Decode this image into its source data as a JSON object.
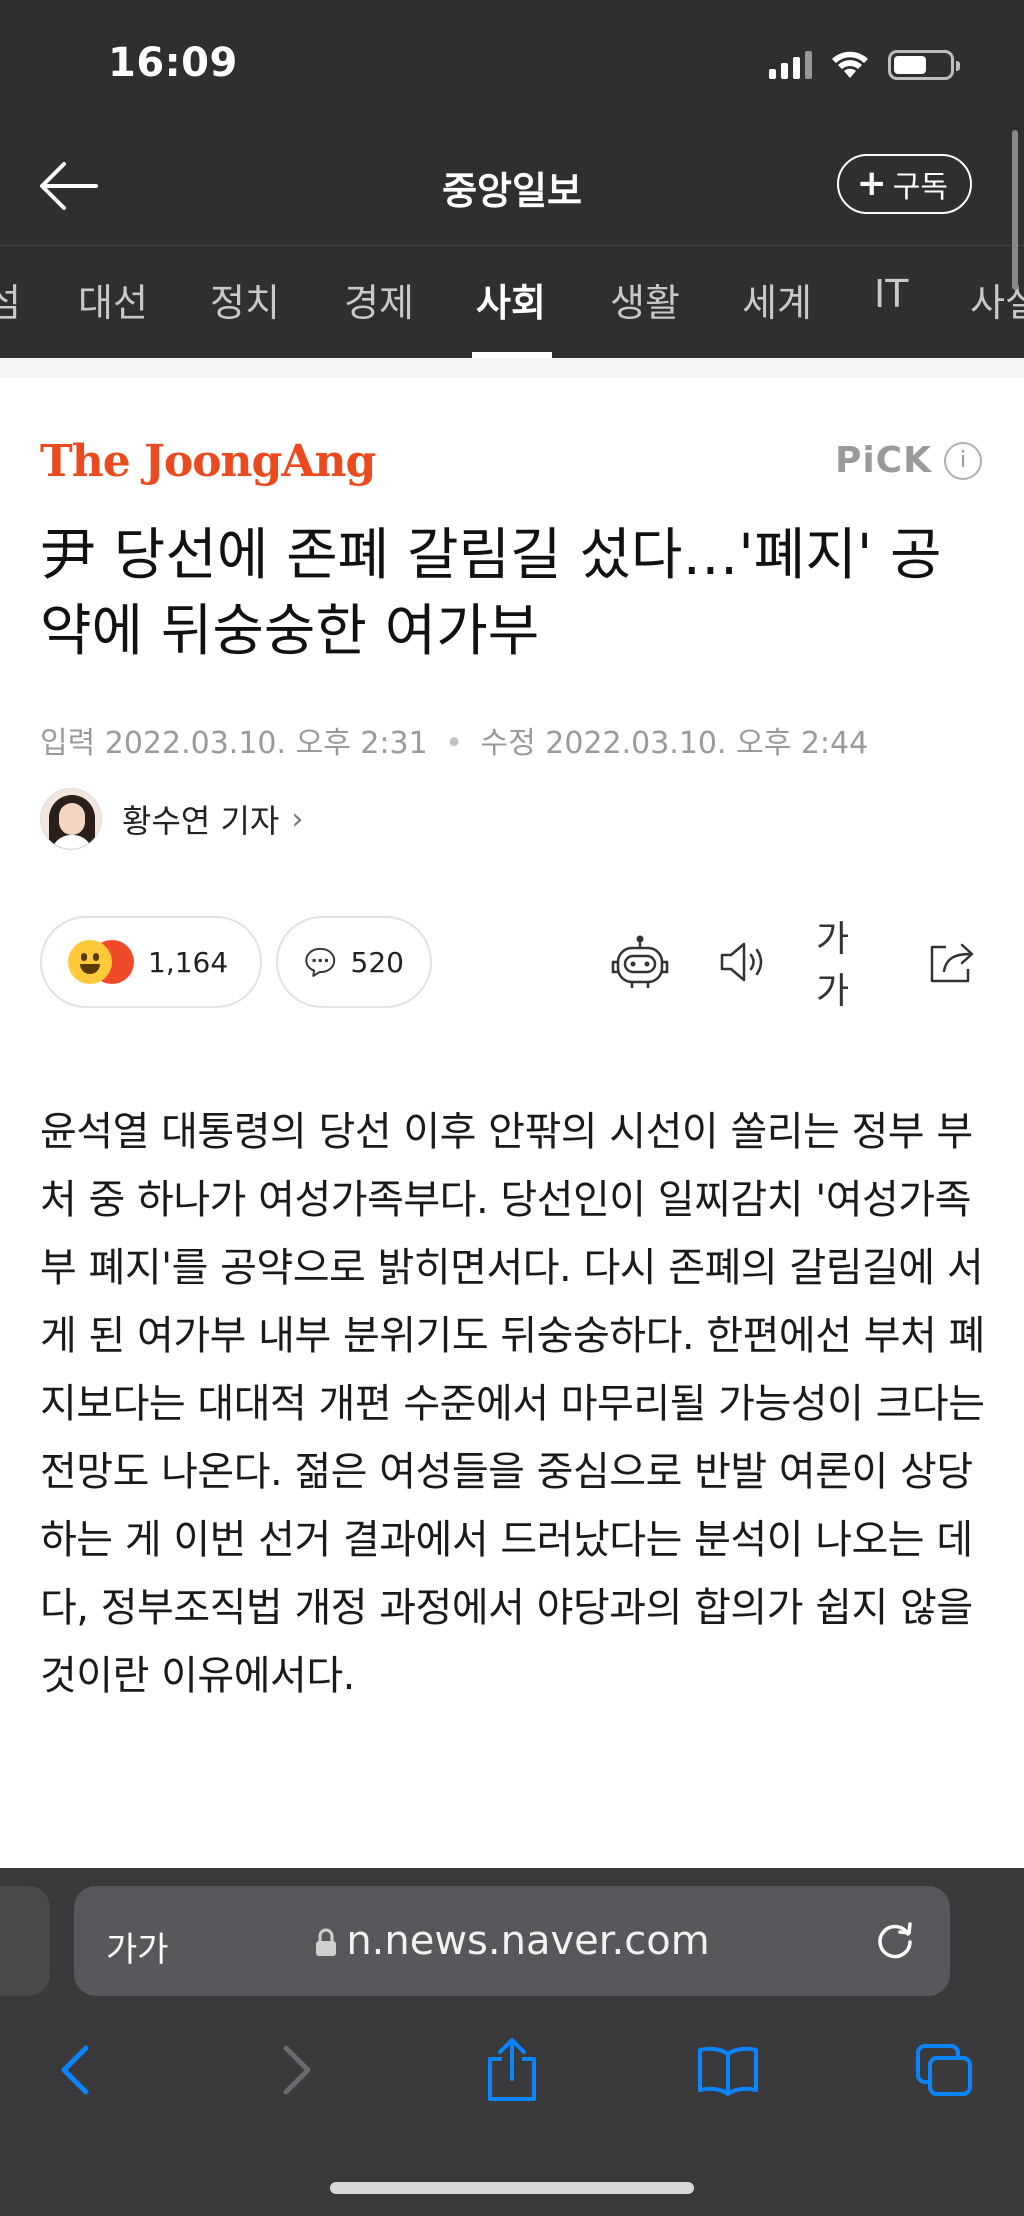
{
  "status_bar": {
    "time": "16:09",
    "battery_level": 0.6
  },
  "header": {
    "title": "중앙일보",
    "subscribe_label": "구독"
  },
  "tabs": [
    "섬",
    "대선",
    "정치",
    "경제",
    "사회",
    "생활",
    "세계",
    "IT",
    "사설"
  ],
  "active_tab": "사회",
  "article": {
    "press_name": "The JoongAng",
    "pick_label": "PiCK",
    "info_glyph": "i",
    "headline": "尹 당선에 존폐 갈림길 섰다…'폐지' 공약에 뒤숭숭한 여가부",
    "input_label": "입력",
    "input_time": "2022.03.10. 오후 2:31",
    "edit_label": "수정",
    "edit_time": "2022.03.10. 오후 2:44",
    "reporter": "황수연 기자",
    "reaction_count": "1,164",
    "comment_count": "520",
    "text_size_label": "가가",
    "body": "윤석열 대통령의 당선 이후 안팎의 시선이 쏠리는 정부 부처 중 하나가 여성가족부다. 당선인이 일찌감치 '여성가족부 폐지'를 공약으로 밝히면서다. 다시 존폐의 갈림길에 서게 된 여가부 내부 분위기도 뒤숭숭하다. 한편에선 부처 폐지보다는 대대적 개편 수준에서 마무리될 가능성이 크다는 전망도 나온다. 젊은 여성들을 중심으로 반발 여론이 상당하는 게 이번 선거 결과에서 드러났다는 분석이 나오는 데다, 정부조직법 개정 과정에서 야당과의 합의가 쉽지 않을 것이란 이유에서다."
  },
  "browser": {
    "aa_label": "가가",
    "url": "n.news.naver.com"
  },
  "colors": {
    "brand": "#ea4a1e",
    "ios_blue": "#0a84ff",
    "dark_bg": "#2f2f31"
  }
}
